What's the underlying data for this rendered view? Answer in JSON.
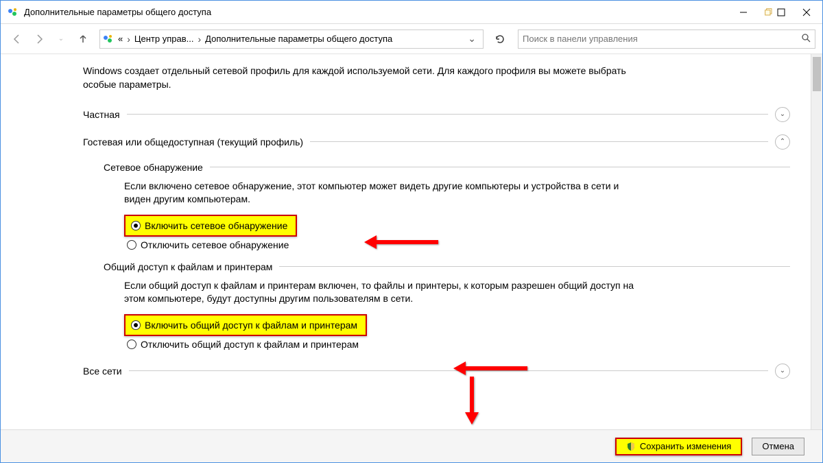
{
  "titlebar": {
    "title": "Дополнительные параметры общего доступа"
  },
  "nav": {
    "back_enabled": false,
    "forward_enabled": false,
    "breadcrumb": {
      "prefix": "«",
      "part1": "Центр управ...",
      "part2": "Дополнительные параметры общего доступа"
    },
    "search_placeholder": "Поиск в панели управления"
  },
  "content": {
    "intro": "Windows создает отдельный сетевой профиль для каждой используемой сети. Для каждого профиля вы можете выбрать особые параметры.",
    "profiles": {
      "private": {
        "label": "Частная",
        "expanded": false
      },
      "guest": {
        "label": "Гостевая или общедоступная (текущий профиль)",
        "expanded": true
      },
      "allnets": {
        "label": "Все сети",
        "expanded": false
      }
    },
    "network_discovery": {
      "heading": "Сетевое обнаружение",
      "desc": "Если включено сетевое обнаружение, этот компьютер может видеть другие компьютеры и устройства в сети и виден другим компьютерам.",
      "opt_on": "Включить сетевое обнаружение",
      "opt_off": "Отключить сетевое обнаружение",
      "selected": "on"
    },
    "file_sharing": {
      "heading": "Общий доступ к файлам и принтерам",
      "desc": "Если общий доступ к файлам и принтерам включен, то файлы и принтеры, к которым разрешен общий доступ на этом компьютере, будут доступны другим пользователям в сети.",
      "opt_on": "Включить общий доступ к файлам и принтерам",
      "opt_off": "Отключить общий доступ к файлам и принтерам",
      "selected": "on"
    }
  },
  "footer": {
    "save": "Сохранить изменения",
    "cancel": "Отмена"
  }
}
